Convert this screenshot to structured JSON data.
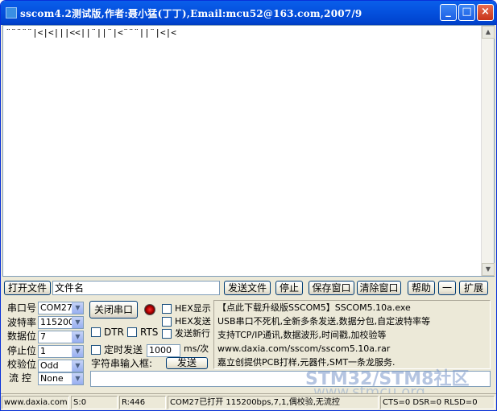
{
  "title": "sscom4.2测试版,作者:聂小猛(丁丁),Email:mcu52@163.com,2007/9",
  "window_buttons": {
    "minimize": "_",
    "maximize": "□",
    "close": "×"
  },
  "receive_text": "¨¨¨¨¨|<|<|||<<||¨||¨|<¨¨¨||¨|<|<",
  "toolbar": {
    "open_file": "打开文件",
    "filename": "文件名",
    "send_file": "发送文件",
    "stop": "停止",
    "save_window": "保存窗口",
    "clear_window": "清除窗口",
    "help": "帮助",
    "dash": "一",
    "expand": "扩展"
  },
  "settings": {
    "port_label": "串口号",
    "port_value": "COM27",
    "baud_label": "波特率",
    "baud_value": "115200",
    "data_label": "数据位",
    "data_value": "7",
    "stop_label": "停止位",
    "stop_value": "1",
    "parity_label": "校验位",
    "parity_value": "Odd",
    "flow_label": "流 控",
    "flow_value": "None"
  },
  "controls": {
    "close_port": "关闭串口",
    "hex_display": "HEX显示",
    "hex_send": "HEX发送",
    "send_newline": "发送新行",
    "dtr": "DTR",
    "rts": "RTS",
    "timed_send": "定时发送",
    "interval_value": "1000",
    "interval_unit": "ms/次",
    "char_input": "字符串输入框:",
    "send": "发送"
  },
  "ad": {
    "line1": "【点此下载升级版SSCOM5】SSCOM5.10a.exe",
    "line2": "USB串口不死机,全新多条发送,数据分包,自定波特率等",
    "line3": "支持TCP/IP通讯,数据波形,时间戳,加校验等",
    "line4": "www.daxia.com/sscom/sscom5.10a.rar",
    "line5": "嘉立创提供PCB打样,元器件,SMT一条龙服务."
  },
  "status": {
    "site": "www.daxia.com",
    "sent": "S:0",
    "received": "R:446",
    "port_state": "COM27已打开  115200bps,7,1,偶校验,无流控",
    "lines": "CTS=0 DSR=0 RLSD=0"
  },
  "watermark": {
    "line1": "STM32/STM8社区",
    "line2": "www.stmcu.org"
  }
}
